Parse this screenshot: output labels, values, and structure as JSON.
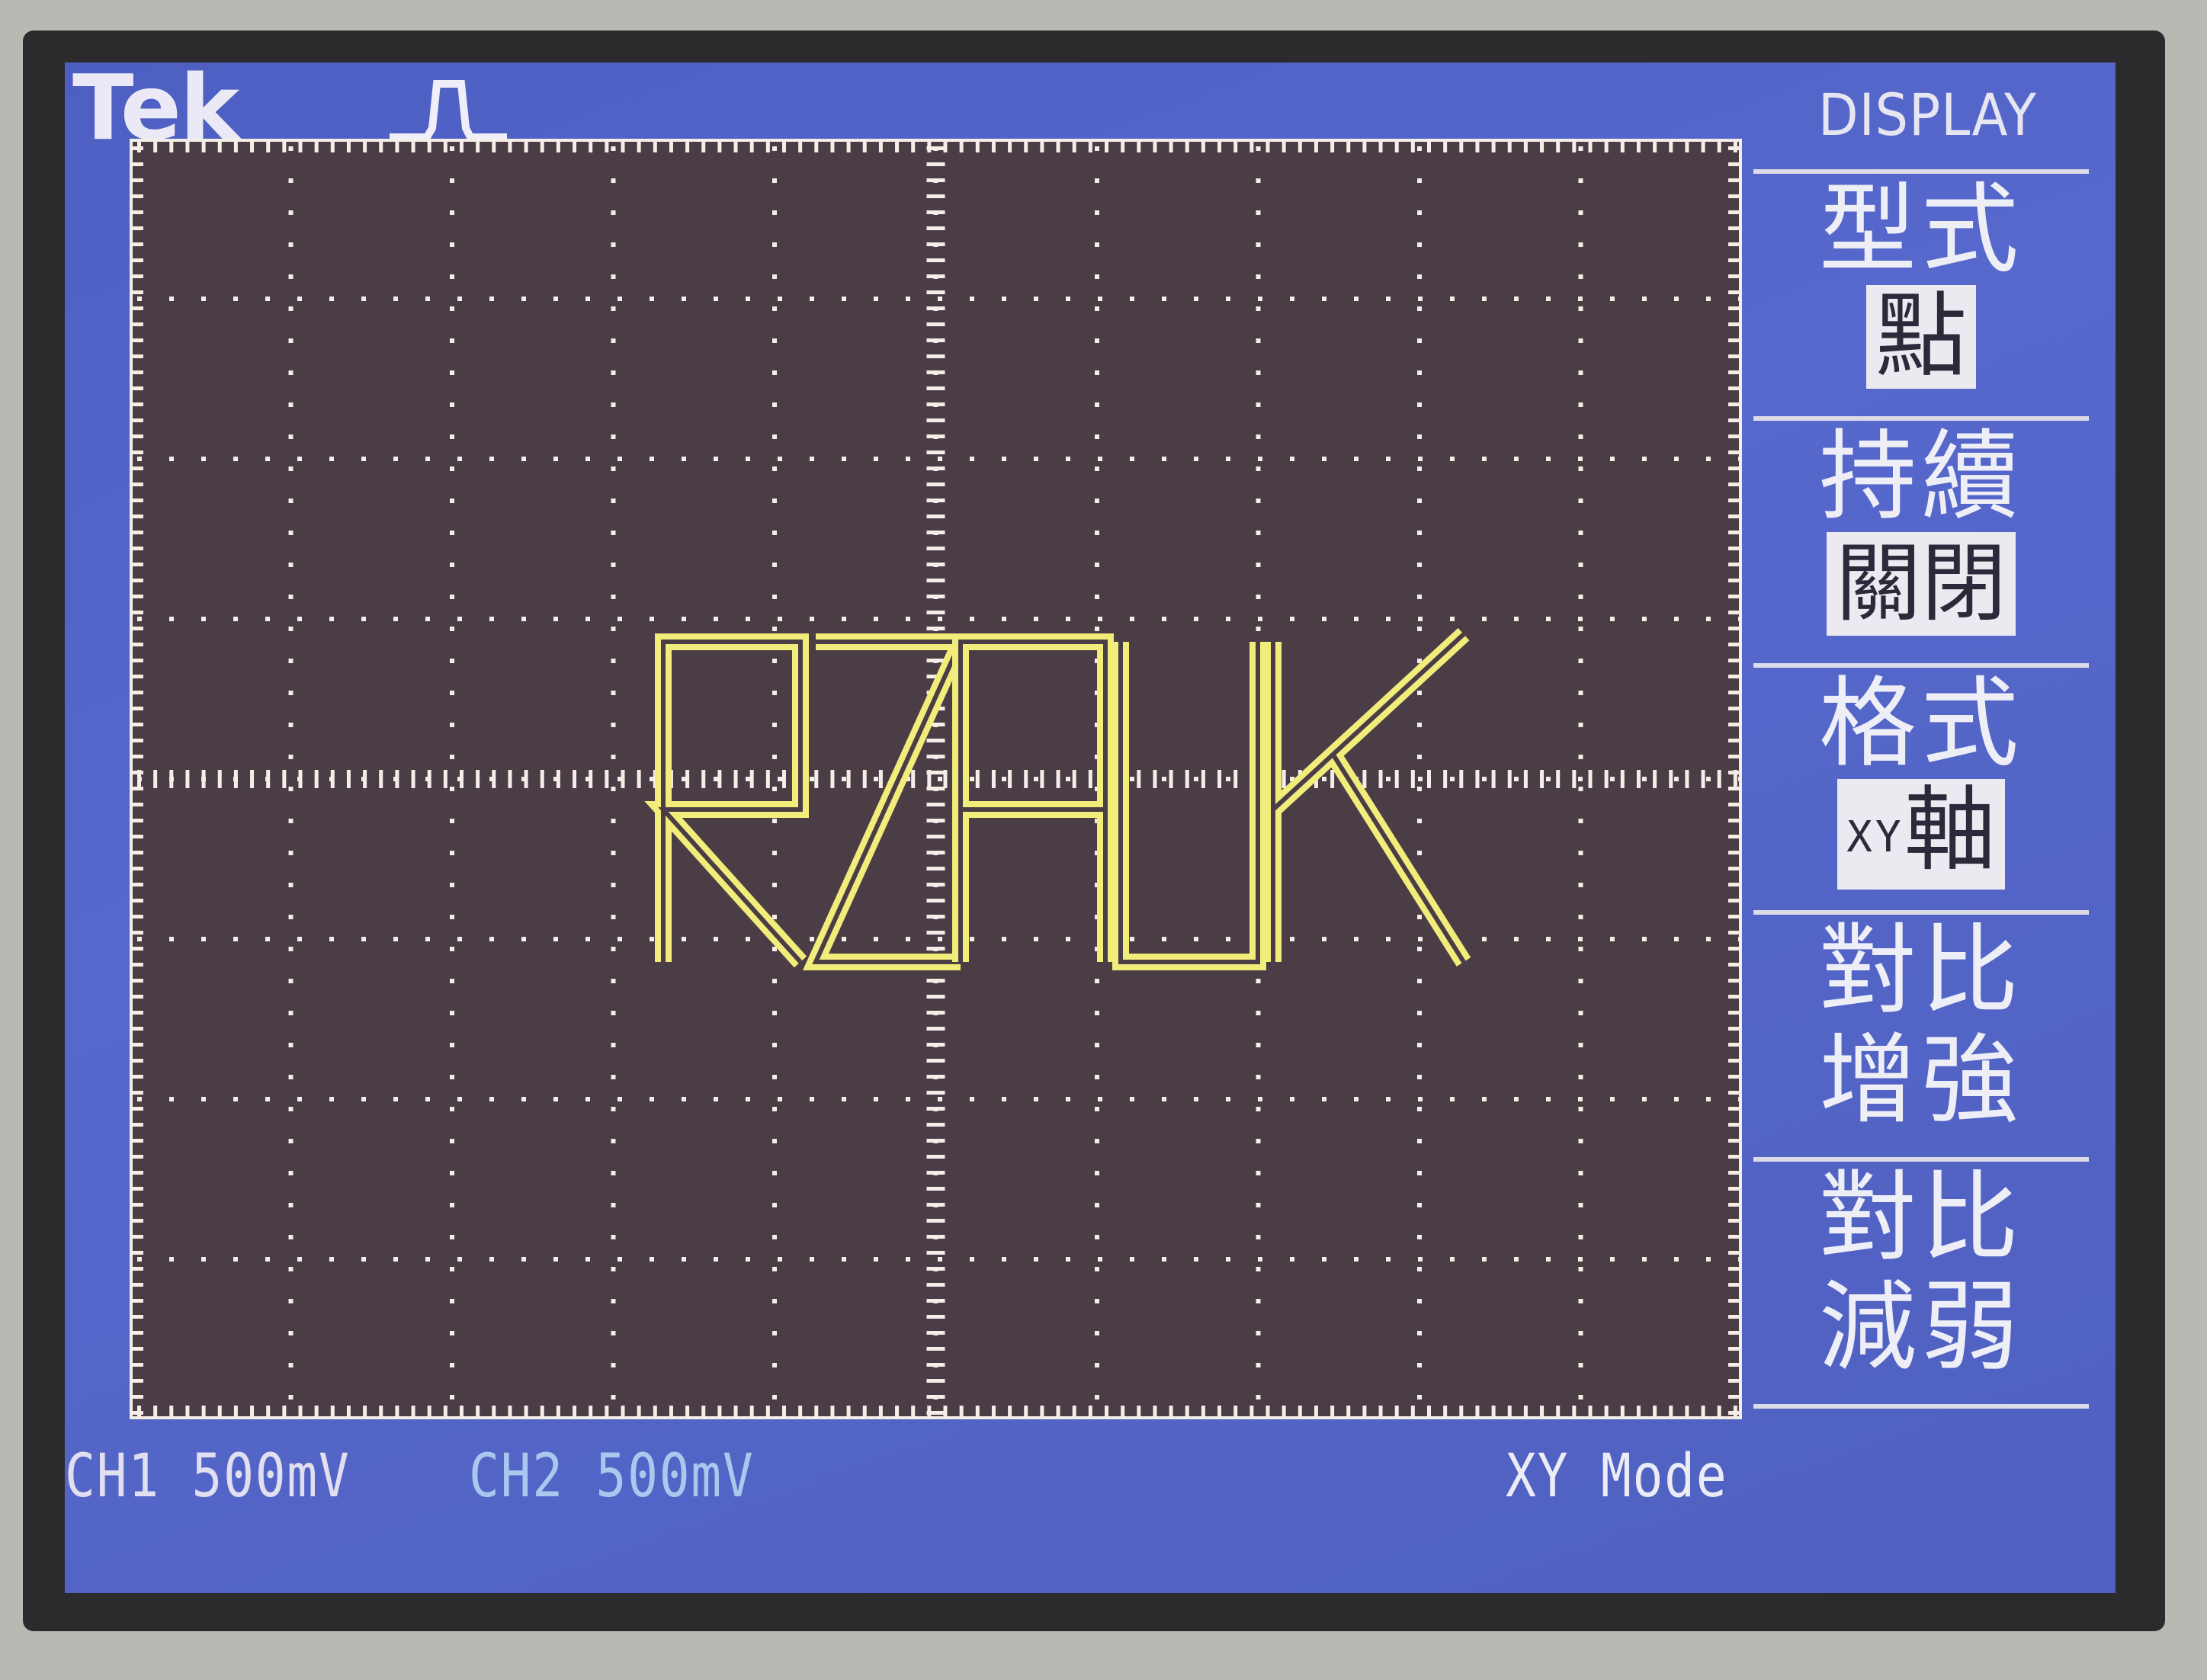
{
  "header": {
    "brand": "Tek",
    "trigger_icon": "rising-pulse-icon"
  },
  "menu": {
    "title": "DISPLAY",
    "items": [
      {
        "label": "型式",
        "value": "點"
      },
      {
        "label": "持續",
        "value": "關閉"
      },
      {
        "label": "格式",
        "value_prefix": "XY",
        "value": "軸"
      },
      {
        "label": "對比",
        "label2": "增強"
      },
      {
        "label": "對比",
        "label2": "減弱"
      }
    ]
  },
  "status": {
    "ch1": "CH1  500mV",
    "ch2": "CH2  500mV",
    "mode": "XY Mode"
  },
  "trace": {
    "text": "RZAUK",
    "color": "#f2ec7a"
  },
  "colors": {
    "screen_bg": "#4d5fc2",
    "graticule_bg": "#4a3d45",
    "grid_dots": "#f4eee8",
    "trace": "#f2ec7a"
  }
}
